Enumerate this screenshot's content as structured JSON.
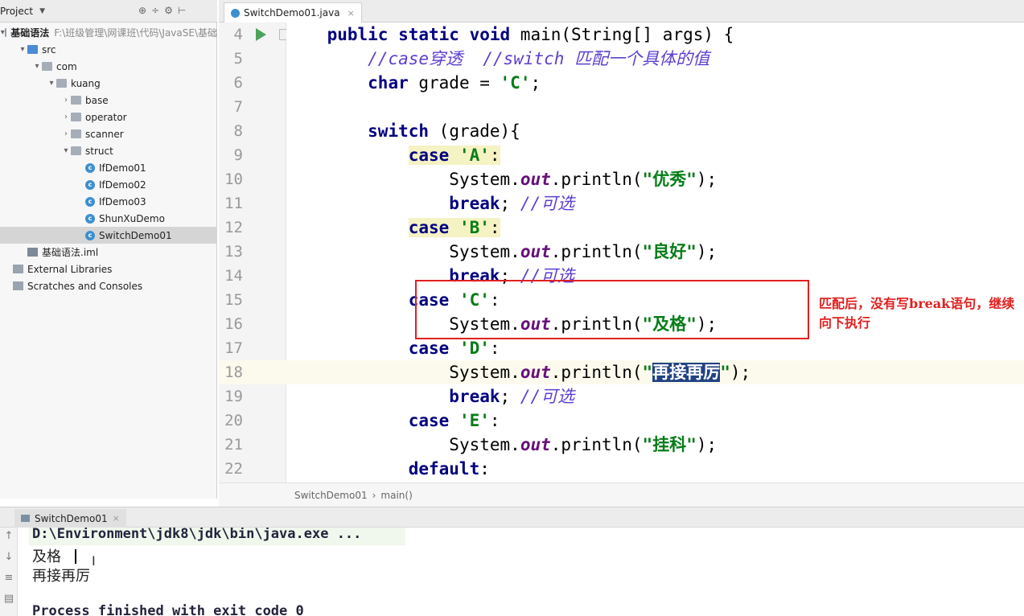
{
  "project_panel": {
    "title": "Project",
    "tools": [
      "⊕",
      "÷",
      "⚙",
      "⊢"
    ],
    "tree": [
      {
        "label": "基础语法",
        "path": "F:\\班级管理\\网课班\\代码\\JavaSE\\基础",
        "indent": 0,
        "icon": "module-folder-icon",
        "arrow": "▾"
      },
      {
        "label": "src",
        "indent": 1,
        "icon": "source-folder-icon",
        "arrow": "▾"
      },
      {
        "label": "com",
        "indent": 2,
        "icon": "package-icon",
        "arrow": "▾"
      },
      {
        "label": "kuang",
        "indent": 3,
        "icon": "package-icon",
        "arrow": "▾"
      },
      {
        "label": "base",
        "indent": 4,
        "icon": "package-icon",
        "arrow": "›"
      },
      {
        "label": "operator",
        "indent": 4,
        "icon": "package-icon",
        "arrow": "›"
      },
      {
        "label": "scanner",
        "indent": 4,
        "icon": "package-icon",
        "arrow": "›"
      },
      {
        "label": "struct",
        "indent": 4,
        "icon": "package-icon",
        "arrow": "▾"
      },
      {
        "label": "IfDemo01",
        "indent": 5,
        "icon": "java-class-icon",
        "arrow": ""
      },
      {
        "label": "IfDemo02",
        "indent": 5,
        "icon": "java-class-icon",
        "arrow": ""
      },
      {
        "label": "IfDemo03",
        "indent": 5,
        "icon": "java-class-icon",
        "arrow": ""
      },
      {
        "label": "ShunXuDemo",
        "indent": 5,
        "icon": "java-class-icon",
        "arrow": ""
      },
      {
        "label": "SwitchDemo01",
        "indent": 5,
        "icon": "java-class-icon",
        "arrow": "",
        "selected": true
      },
      {
        "label": "基础语法.iml",
        "indent": 1,
        "icon": "iml-file-icon",
        "arrow": ""
      },
      {
        "label": "External Libraries",
        "indent": 0,
        "icon": "library-icon",
        "arrow": ""
      },
      {
        "label": "Scratches and Consoles",
        "indent": 0,
        "icon": "scratches-icon",
        "arrow": ""
      }
    ]
  },
  "editor": {
    "tab_label": "SwitchDemo01.java",
    "breadcrumb": [
      "SwitchDemo01",
      "main()"
    ],
    "current_line": 18,
    "lines": [
      {
        "n": "4",
        "tokens": [
          [
            "    ",
            ""
          ],
          [
            "public static void ",
            "kw"
          ],
          [
            "main(String[] args) {",
            ""
          ]
        ]
      },
      {
        "n": "5",
        "tokens": [
          [
            "        ",
            ""
          ],
          [
            "//case穿透  //switch 匹配一个具体的值",
            "cm"
          ]
        ]
      },
      {
        "n": "6",
        "tokens": [
          [
            "        ",
            ""
          ],
          [
            "char ",
            "kw"
          ],
          [
            "grade = ",
            ""
          ],
          [
            "'C'",
            "str"
          ],
          [
            ";",
            ""
          ]
        ]
      },
      {
        "n": "7",
        "tokens": []
      },
      {
        "n": "8",
        "tokens": [
          [
            "        ",
            ""
          ],
          [
            "switch ",
            "kw"
          ],
          [
            "(grade){",
            ""
          ]
        ]
      },
      {
        "n": "9",
        "tokens": [
          [
            "            ",
            ""
          ],
          [
            "case ",
            "kw hl-case"
          ],
          [
            "'A'",
            "str hl-case"
          ],
          [
            ":",
            "hl-case"
          ]
        ]
      },
      {
        "n": "10",
        "tokens": [
          [
            "                ",
            ""
          ],
          [
            "System.",
            ""
          ],
          [
            "out",
            "fld"
          ],
          [
            ".println(",
            ""
          ],
          [
            "\"优秀\"",
            "str"
          ],
          [
            ");",
            ""
          ]
        ]
      },
      {
        "n": "11",
        "tokens": [
          [
            "                ",
            ""
          ],
          [
            "break",
            "kw"
          ],
          [
            "; ",
            ""
          ],
          [
            "//可选",
            "cm"
          ]
        ]
      },
      {
        "n": "12",
        "tokens": [
          [
            "            ",
            ""
          ],
          [
            "case ",
            "kw hl-case"
          ],
          [
            "'B'",
            "str hl-case"
          ],
          [
            ":",
            "hl-case"
          ]
        ]
      },
      {
        "n": "13",
        "tokens": [
          [
            "                ",
            ""
          ],
          [
            "System.",
            ""
          ],
          [
            "out",
            "fld"
          ],
          [
            ".println(",
            ""
          ],
          [
            "\"良好\"",
            "str"
          ],
          [
            ");",
            ""
          ]
        ]
      },
      {
        "n": "14",
        "tokens": [
          [
            "                ",
            ""
          ],
          [
            "break",
            "kw"
          ],
          [
            "; ",
            ""
          ],
          [
            "//可选",
            "cm"
          ]
        ]
      },
      {
        "n": "15",
        "tokens": [
          [
            "            ",
            ""
          ],
          [
            "case ",
            "kw"
          ],
          [
            "'C'",
            "str"
          ],
          [
            ":",
            ""
          ]
        ]
      },
      {
        "n": "16",
        "tokens": [
          [
            "                ",
            ""
          ],
          [
            "System.",
            ""
          ],
          [
            "out",
            "fld"
          ],
          [
            ".println(",
            ""
          ],
          [
            "\"及格\"",
            "str"
          ],
          [
            ");",
            ""
          ]
        ]
      },
      {
        "n": "17",
        "tokens": [
          [
            "            ",
            ""
          ],
          [
            "case ",
            "kw"
          ],
          [
            "'D'",
            "str"
          ],
          [
            ":",
            ""
          ]
        ]
      },
      {
        "n": "18",
        "tokens": [
          [
            "                ",
            ""
          ],
          [
            "System.",
            ""
          ],
          [
            "out",
            "fld"
          ],
          [
            ".println(",
            ""
          ],
          [
            "\"",
            "str"
          ],
          [
            "再接再厉",
            "str sel"
          ],
          [
            "\"",
            "str"
          ],
          [
            ");",
            ""
          ]
        ]
      },
      {
        "n": "19",
        "tokens": [
          [
            "                ",
            ""
          ],
          [
            "break",
            "kw"
          ],
          [
            "; ",
            ""
          ],
          [
            "//可选",
            "cm"
          ]
        ]
      },
      {
        "n": "20",
        "tokens": [
          [
            "            ",
            ""
          ],
          [
            "case ",
            "kw"
          ],
          [
            "'E'",
            "str"
          ],
          [
            ":",
            ""
          ]
        ]
      },
      {
        "n": "21",
        "tokens": [
          [
            "                ",
            ""
          ],
          [
            "System.",
            ""
          ],
          [
            "out",
            "fld"
          ],
          [
            ".println(",
            ""
          ],
          [
            "\"挂科\"",
            "str"
          ],
          [
            ");",
            ""
          ]
        ]
      },
      {
        "n": "22",
        "tokens": [
          [
            "            ",
            ""
          ],
          [
            "default",
            "kw"
          ],
          [
            ":",
            ""
          ]
        ]
      }
    ]
  },
  "annotation": {
    "text": "匹配后，没有写break语句，继续向下执行",
    "color": "#e02020"
  },
  "run_panel": {
    "tab_label": "SwitchDemo01",
    "command": "D:\\Environment\\jdk8\\jdk\\bin\\java.exe ...",
    "output": [
      "及格",
      "再接再厉"
    ],
    "exit_message": "Process finished with exit code 0"
  }
}
